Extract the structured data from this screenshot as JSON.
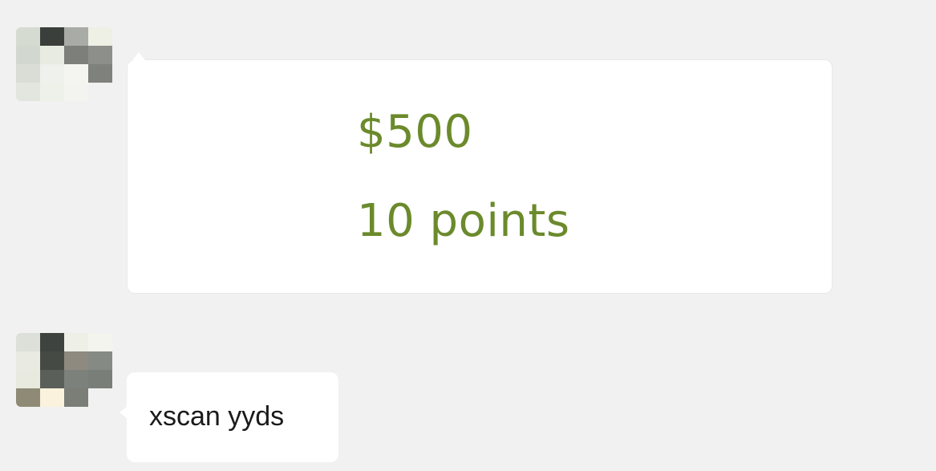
{
  "messages": [
    {
      "type": "card",
      "amount": "$500",
      "points": "10 points"
    },
    {
      "type": "text",
      "text": "xscan yyds"
    }
  ],
  "colors": {
    "background": "#f1f1f1",
    "bubble": "#ffffff",
    "card_text": "#6b8a2c",
    "message_text": "#1a1a1a"
  },
  "avatars": [
    {
      "name": "avatar-pixelated-1",
      "pixels": [
        "#d6dbd2",
        "#3b3f3b",
        "#a9aca6",
        "#eef0e6",
        "#d2d8cf",
        "#e7ebe1",
        "#7c7f7a",
        "#8d8f8a",
        "#d9ddd5",
        "#eef1ec",
        "#f4f5f1",
        "#7f817c",
        "#e3e6df",
        "#eef1ea",
        "#f3f4ef",
        "#f1f1f1"
      ]
    },
    {
      "name": "avatar-pixelated-2",
      "pixels": [
        "#dde0d8",
        "#3e433f",
        "#eef0e7",
        "#f3f4ee",
        "#e9ebe3",
        "#454a45",
        "#8e8a80",
        "#858a85",
        "#e8eadf",
        "#5b5f59",
        "#7d817c",
        "#7a7e78",
        "#8f8a76",
        "#fbf2de",
        "#7a7e77",
        "#f1f1f1"
      ]
    }
  ]
}
